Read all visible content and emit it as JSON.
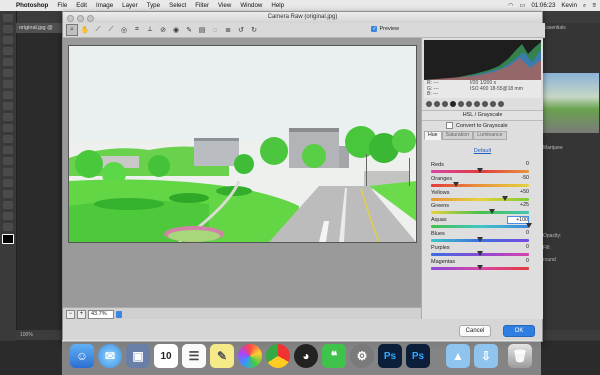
{
  "menubar": {
    "app": "Photoshop",
    "items": [
      "File",
      "Edit",
      "Image",
      "Layer",
      "Type",
      "Select",
      "Filter",
      "View",
      "Window",
      "Help"
    ],
    "clock": "01:06:23",
    "user": "Kevin"
  },
  "ps": {
    "doc_tab": "original.jpg @",
    "bottom_zoom": "100%",
    "panel_labels": [
      "Essentials",
      "Marquee",
      "Opacity:",
      "Fill:",
      "round"
    ]
  },
  "dialog": {
    "title": "Camera Raw (original.jpg)",
    "preview_label": "Preview",
    "zoom_value": "43.7%",
    "cancel_label": "Cancel",
    "ok_label": "OK"
  },
  "readout": {
    "rgb_lines": [
      "R: ---",
      "G: ---",
      "B: ---"
    ],
    "cam_lines": [
      "f/20   1/200 s",
      "ISO 400   18-55@18 mm"
    ]
  },
  "hsl": {
    "header": "HSL / Grayscale",
    "grayscale_label": "Convert to Grayscale",
    "tabs": [
      "Hue",
      "Saturation",
      "Luminance"
    ],
    "default_link": "Default",
    "sliders": [
      {
        "label": "Reds",
        "value": "0",
        "pos": 0.5,
        "grad": "linear-gradient(90deg,#d844a8,#e23b3b,#e8943b)"
      },
      {
        "label": "Oranges",
        "value": "-50",
        "pos": 0.25,
        "grad": "linear-gradient(90deg,#e23b3b,#e8943b,#e6d23c)"
      },
      {
        "label": "Yellows",
        "value": "+50",
        "pos": 0.75,
        "grad": "linear-gradient(90deg,#e8943b,#e6d23c,#7ccd3a)"
      },
      {
        "label": "Greens",
        "value": "+25",
        "pos": 0.625,
        "grad": "linear-gradient(90deg,#e6d23c,#47c04a,#3fc6b6)"
      },
      {
        "label": "Aquas",
        "value": "+100",
        "pos": 1.0,
        "grad": "linear-gradient(90deg,#47c04a,#3fc6c6,#3c86e0)",
        "boxed": true
      },
      {
        "label": "Blues",
        "value": "0",
        "pos": 0.5,
        "grad": "linear-gradient(90deg,#3fc6c6,#3c6ee0,#7a4ae0)"
      },
      {
        "label": "Purples",
        "value": "0",
        "pos": 0.5,
        "grad": "linear-gradient(90deg,#3c6ee0,#8a48d8,#d844a8)"
      },
      {
        "label": "Magentas",
        "value": "0",
        "pos": 0.5,
        "grad": "linear-gradient(90deg,#8a48d8,#d844a8,#e23b3b)"
      }
    ]
  },
  "dock": {
    "calendar_day": "10",
    "ps_label": "Ps"
  },
  "colors": {
    "accent": "#2f7fe3",
    "dialog_bg": "#d6d6d6"
  }
}
